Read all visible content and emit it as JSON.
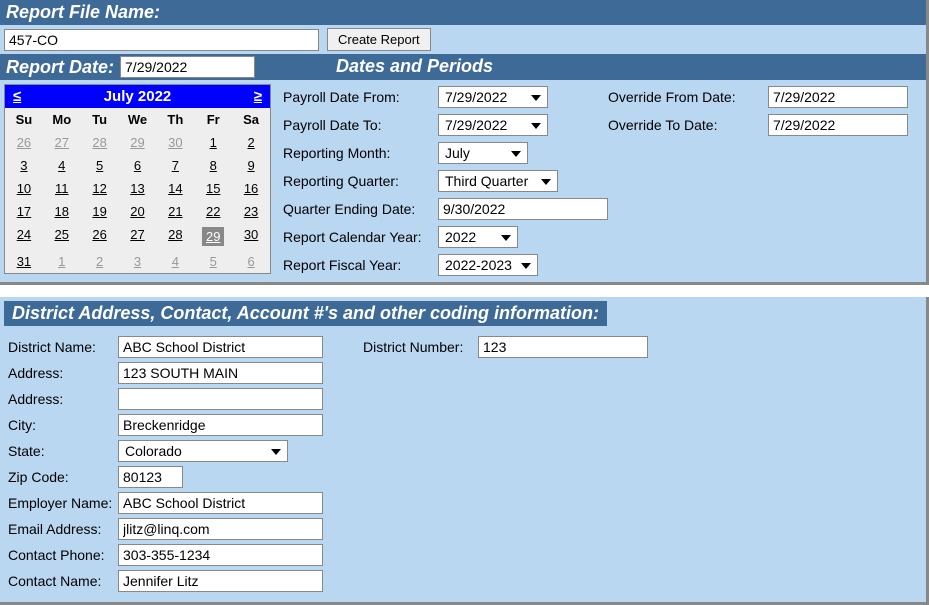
{
  "report": {
    "file_name_label": "Report File Name:",
    "file_name_value": "457-CO",
    "create_btn": "Create Report",
    "report_date_label": "Report Date:",
    "report_date_value": "7/29/2022"
  },
  "calendar": {
    "prev": "≤",
    "next": "≥",
    "title": "July 2022",
    "dow": [
      "Su",
      "Mo",
      "Tu",
      "We",
      "Th",
      "Fr",
      "Sa"
    ],
    "weeks": [
      [
        {
          "d": "26",
          "o": true
        },
        {
          "d": "27",
          "o": true
        },
        {
          "d": "28",
          "o": true
        },
        {
          "d": "29",
          "o": true
        },
        {
          "d": "30",
          "o": true
        },
        {
          "d": "1"
        },
        {
          "d": "2"
        }
      ],
      [
        {
          "d": "3"
        },
        {
          "d": "4"
        },
        {
          "d": "5"
        },
        {
          "d": "6"
        },
        {
          "d": "7"
        },
        {
          "d": "8"
        },
        {
          "d": "9"
        }
      ],
      [
        {
          "d": "10"
        },
        {
          "d": "11"
        },
        {
          "d": "12"
        },
        {
          "d": "13"
        },
        {
          "d": "14"
        },
        {
          "d": "15"
        },
        {
          "d": "16"
        }
      ],
      [
        {
          "d": "17"
        },
        {
          "d": "18"
        },
        {
          "d": "19"
        },
        {
          "d": "20"
        },
        {
          "d": "21"
        },
        {
          "d": "22"
        },
        {
          "d": "23"
        }
      ],
      [
        {
          "d": "24"
        },
        {
          "d": "25"
        },
        {
          "d": "26"
        },
        {
          "d": "27"
        },
        {
          "d": "28"
        },
        {
          "d": "29",
          "sel": true
        },
        {
          "d": "30"
        }
      ],
      [
        {
          "d": "31"
        },
        {
          "d": "1",
          "o": true
        },
        {
          "d": "2",
          "o": true
        },
        {
          "d": "3",
          "o": true
        },
        {
          "d": "4",
          "o": true
        },
        {
          "d": "5",
          "o": true
        },
        {
          "d": "6",
          "o": true
        }
      ]
    ]
  },
  "dates": {
    "header": "Dates and Periods",
    "payroll_from_label": "Payroll Date From:",
    "payroll_from_value": "7/29/2022",
    "override_from_label": "Override From Date:",
    "override_from_value": "7/29/2022",
    "payroll_to_label": "Payroll Date To:",
    "payroll_to_value": "7/29/2022",
    "override_to_label": "Override To Date:",
    "override_to_value": "7/29/2022",
    "reporting_month_label": "Reporting Month:",
    "reporting_month_value": "July",
    "reporting_quarter_label": "Reporting Quarter:",
    "reporting_quarter_value": "Third Quarter",
    "quarter_ending_label": "Quarter Ending Date:",
    "quarter_ending_value": "9/30/2022",
    "calendar_year_label": "Report Calendar Year:",
    "calendar_year_value": "2022",
    "fiscal_year_label": "Report Fiscal Year:",
    "fiscal_year_value": "2022-2023"
  },
  "district": {
    "header": "District Address, Contact, Account #'s and other coding information:",
    "name_label": "District Name:",
    "name_value": "ABC School District",
    "number_label": "District Number:",
    "number_value": "123",
    "address1_label": "Address:",
    "address1_value": "123 SOUTH MAIN",
    "address2_label": "Address:",
    "address2_value": "",
    "city_label": "City:",
    "city_value": "Breckenridge",
    "state_label": "State:",
    "state_value": "Colorado",
    "zip_label": "Zip Code:",
    "zip_value": "80123",
    "employer_label": "Employer Name:",
    "employer_value": "ABC School District",
    "email_label": "Email Address:",
    "email_value": "jlitz@linq.com",
    "phone_label": "Contact Phone:",
    "phone_value": "303-355-1234",
    "contact_label": "Contact Name:",
    "contact_value": "Jennifer Litz"
  }
}
